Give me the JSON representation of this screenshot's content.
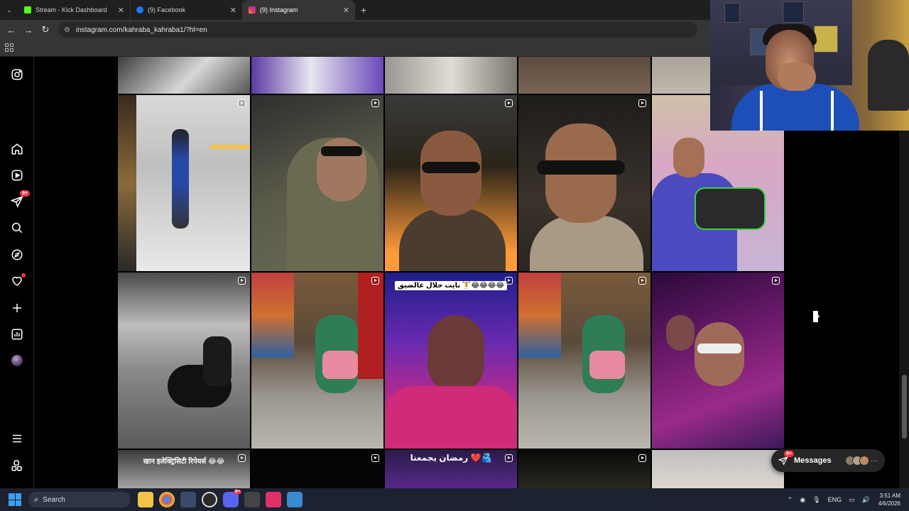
{
  "browser": {
    "tabs": [
      {
        "label": "Stream - Kick Dashboard",
        "favicon_color": "#53fc18",
        "active": false
      },
      {
        "label": "(9) Facebook",
        "favicon_color": "#1877f2",
        "active": false
      },
      {
        "label": "(9) Instagram",
        "favicon_color": "#e1306c",
        "active": true
      }
    ],
    "url": "instagram.com/kahraba_kahraba1/?hl=en"
  },
  "sidebar": {
    "notifications_badge": "9+"
  },
  "grid": {
    "captions": {
      "row3_col3": "نايت حلال عالضيق 🏋😂😂😂😂",
      "row4_col1": "खान इलेक्ट्रिसिटी रिपेयर्स 😂😂",
      "row4_col3": "رمضان يجمعنا ❤️🫂"
    }
  },
  "messages": {
    "label": "Messages",
    "badge": "9+"
  },
  "taskbar": {
    "search_placeholder": "Search",
    "discord_badge": "9+",
    "language": "ENG",
    "time": "3:51 AM",
    "date": "4/6/2026"
  }
}
